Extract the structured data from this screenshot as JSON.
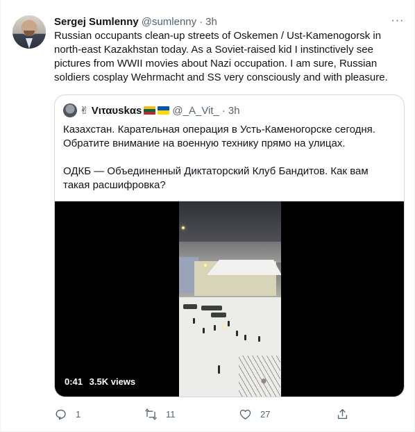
{
  "tweet": {
    "author_name": "Sergej Sumlenny",
    "handle": "@sumlenny",
    "separator": "·",
    "time": "3h",
    "more_label": "···",
    "text": "Russian occupants clean-up streets of Oskemen / Ust-Kamenogorsk in north-east Kazakhstan today. As a Soviet-raised kid I instinctively see pictures from WWII movies about Nazi occupation. I am sure, Russian soldiers cosplay Wehrmacht and SS very consciously and with pleasure."
  },
  "quote": {
    "author_emoji": "✌",
    "author_name": "Vιταυskαs",
    "handle": "@_A_Vit_",
    "separator": "·",
    "time": "3h",
    "paragraph_1": "Казахстан. Карательная операция в Усть-Каменогорске сегодня. Обратите внимание на военную технику прямо на улицах.",
    "paragraph_2": "ОДКБ — Объединенный Диктаторский Клуб Бандитов. Как вам такая расшифровка?",
    "video": {
      "duration": "0:41",
      "views": "3.5K views"
    }
  },
  "actions": {
    "reply_count": "1",
    "retweet_count": "11",
    "like_count": "27"
  },
  "icons": {
    "reply": "reply-icon",
    "retweet": "retweet-icon",
    "like": "heart-icon",
    "share": "share-icon"
  },
  "colors": {
    "text_primary": "#0f1419",
    "text_secondary": "#536471",
    "border": "#cfd9de"
  }
}
